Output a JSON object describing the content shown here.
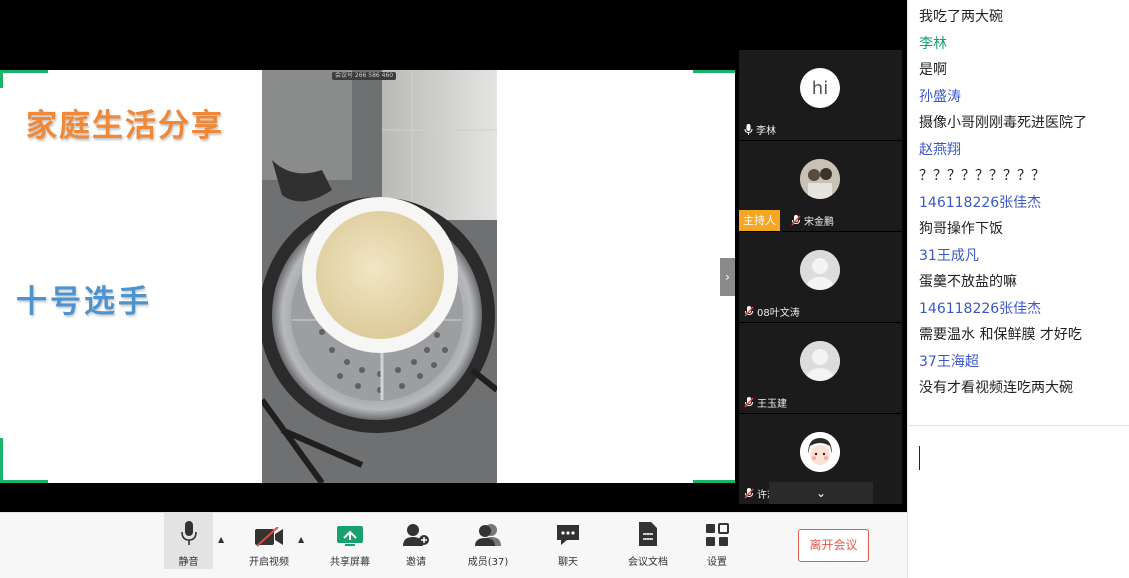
{
  "share": {
    "title": "家庭生活分享",
    "subtitle": "十号选手",
    "video_badge": "会议号 266 586 460"
  },
  "participants": [
    {
      "name": "李林",
      "avatar": "hi",
      "host": false
    },
    {
      "name": "宋金鹏",
      "avatar": "photo",
      "host": true
    },
    {
      "name": "08叶文涛",
      "avatar": "default",
      "host": false
    },
    {
      "name": "王玉建",
      "avatar": "default",
      "host": false
    },
    {
      "name": "许志远",
      "avatar": "cartoon",
      "host": false
    }
  ],
  "host_badge": "主持人",
  "toolbar": {
    "mute": "静音",
    "video": "开启视频",
    "share": "共享屏幕",
    "invite": "邀请",
    "members": "成员(37)",
    "chat": "聊天",
    "docs": "会议文档",
    "settings": "设置",
    "leave": "离开会议"
  },
  "chat": {
    "messages": [
      {
        "type": "text",
        "text": "我吃了两大碗"
      },
      {
        "type": "sender",
        "text": "李林",
        "color": "#1aa06f"
      },
      {
        "type": "text",
        "text": "是啊"
      },
      {
        "type": "sender",
        "text": "孙盛涛",
        "color": "#3a57c9"
      },
      {
        "type": "text",
        "text": "摄像小哥刚刚毒死进医院了"
      },
      {
        "type": "sender",
        "text": "赵燕翔",
        "color": "#3a57c9"
      },
      {
        "type": "text",
        "text": "？？？？？？？？？"
      },
      {
        "type": "sender",
        "text": "146118226张佳杰",
        "color": "#3a57c9"
      },
      {
        "type": "text",
        "text": "狗哥操作下饭"
      },
      {
        "type": "sender",
        "text": "31王成凡",
        "color": "#3a57c9"
      },
      {
        "type": "text",
        "text": "蛋羹不放盐的嘛"
      },
      {
        "type": "sender",
        "text": "146118226张佳杰",
        "color": "#3a57c9"
      },
      {
        "type": "text",
        "text": "需要温水 和保鲜膜 才好吃"
      },
      {
        "type": "sender",
        "text": "37王海超",
        "color": "#3a57c9"
      },
      {
        "type": "text",
        "text": "没有才看视频连吃两大碗"
      }
    ]
  }
}
